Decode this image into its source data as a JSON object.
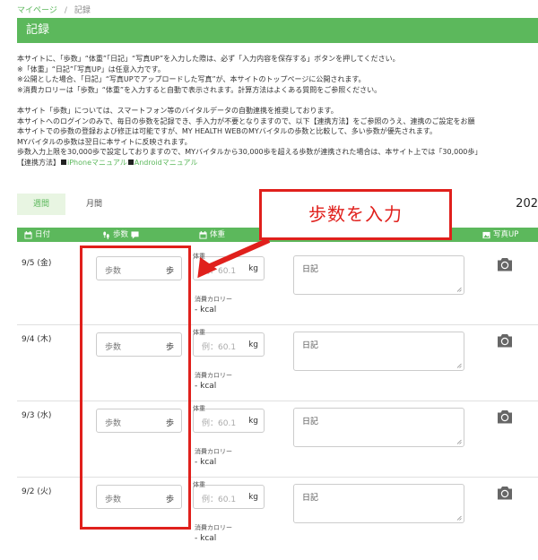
{
  "breadcrumb": {
    "home": "マイページ",
    "separator": "/",
    "current": "記録"
  },
  "page_title": "記録",
  "notice": {
    "lines": [
      "本サイトに、「歩数」“体重”「日記」“写真UP”を入力した際は、必ず「入力内容を保存する」ボタンを押してください。",
      "※「体重」“日記”「写真UP」は任意入力です。",
      "※公開とした場合、「日記」“写真UPでアップロードした写真”が、本サイトのトップページに公開されます。",
      "※消費カロリーは「歩数」“体重”を入力すると自動で表示されます。計算方法はよくある質問をご参照ください。",
      "",
      "本サイト「歩数」については、スマートフォン等のバイタルデータの自動連携を推奨しております。",
      "本サイトへのログインのみで、毎日の歩数を記録でき、手入力が不要となりますので、以下【連携方法】をご参照のうえ、連携のご設定をお願",
      "本サイトでの歩数の登録および修正は可能ですが、MY HEALTH WEBのMYバイタルの歩数と比較して、多い歩数が優先されます。",
      "MYバイタルの歩数は翌日に本サイトに反映されます。",
      "歩数入力上限を30,000歩で設定しておりますので、MYバイタルから30,000歩を超える歩数が連携された場合は、本サイト上では「30,000歩」"
    ],
    "link_prefix": "【連携方法】",
    "iphone_link": "iPhoneマニュアル",
    "android_link": "Androidマニュアル"
  },
  "tabs": {
    "week": "週間",
    "month": "月間"
  },
  "year_label": "202",
  "headers": {
    "date": "日付",
    "steps": "歩数",
    "weight": "体重",
    "photo": "写真UP"
  },
  "rows": [
    {
      "date": "9/5 (金)",
      "steps_placeholder": "歩数",
      "steps_unit": "歩",
      "weight_label": "体重",
      "weight_placeholder": "例：60.1",
      "weight_unit": "kg",
      "calorie_label": "消費カロリー",
      "calorie_value": "- kcal",
      "diary_placeholder": "日記"
    },
    {
      "date": "9/4 (木)",
      "steps_placeholder": "歩数",
      "steps_unit": "歩",
      "weight_label": "体重",
      "weight_placeholder": "例：60.1",
      "weight_unit": "kg",
      "calorie_label": "消費カロリー",
      "calorie_value": "- kcal",
      "diary_placeholder": "日記"
    },
    {
      "date": "9/3 (水)",
      "steps_placeholder": "歩数",
      "steps_unit": "歩",
      "weight_label": "体重",
      "weight_placeholder": "例：60.1",
      "weight_unit": "kg",
      "calorie_label": "消費カロリー",
      "calorie_value": "- kcal",
      "diary_placeholder": "日記"
    },
    {
      "date": "9/2 (火)",
      "steps_placeholder": "歩数",
      "steps_unit": "歩",
      "weight_label": "体重",
      "weight_placeholder": "例：60.1",
      "weight_unit": "kg",
      "calorie_label": "消費カロリー",
      "calorie_value": "- kcal",
      "diary_placeholder": "日記"
    }
  ],
  "annotation": {
    "callout_text": "歩数を入力"
  },
  "colors": {
    "brand_green": "#5cb85c",
    "annotation_red": "#e0201c"
  },
  "icons": {
    "date": "calendar-icon",
    "steps": "footprints-icon",
    "steps_comment": "comment-icon",
    "weight": "calendar-icon",
    "photo": "image-icon",
    "row_action": "camera-icon"
  }
}
